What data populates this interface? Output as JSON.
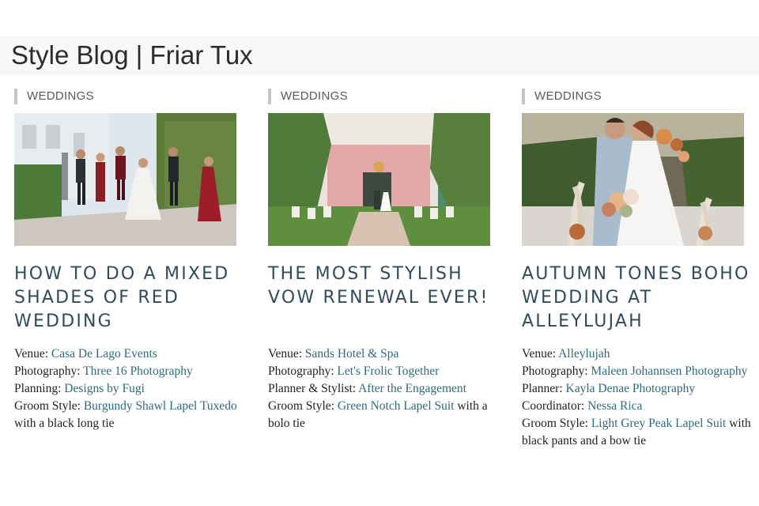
{
  "page": {
    "title": "Style Blog | Friar Tux"
  },
  "colors": {
    "headline": "#2f4b5c",
    "link": "#2e6a7d",
    "category_bar": "#c6c6c6",
    "header_bg": "#f8f8f8"
  },
  "posts": [
    {
      "category": "WEDDINGS",
      "image_alt": "Wedding party jumping in street beside ivy wall",
      "title": "HOW TO DO A MIXED SHADES OF RED WEDDING",
      "credits": [
        {
          "label": "Venue: ",
          "link": "Casa De Lago Events",
          "suffix": ""
        },
        {
          "label": "Photography: ",
          "link": "Three 16 Photography",
          "suffix": ""
        },
        {
          "label": "Planning: ",
          "link": "Designs by Fugi",
          "suffix": ""
        },
        {
          "label": "Groom Style: ",
          "link": "Burgundy Shawl Lapel Tuxedo",
          "suffix": " with a black long tie"
        }
      ]
    },
    {
      "category": "WEDDINGS",
      "image_alt": "Outdoor vow renewal ceremony at pink building",
      "title": "THE MOST STYLISH VOW RENEWAL EVER!",
      "credits": [
        {
          "label": "Venue: ",
          "link": "Sands Hotel & Spa",
          "suffix": ""
        },
        {
          "label": "Photography: ",
          "link": "Let's Frolic Together",
          "suffix": ""
        },
        {
          "label": "Planner & Stylist: ",
          "link": "After the Engagement",
          "suffix": ""
        },
        {
          "label": "Groom Style: ",
          "link": "Green Notch Lapel Suit",
          "suffix": " with a bolo tie"
        }
      ]
    },
    {
      "category": "WEDDINGS",
      "image_alt": "Couple embracing with autumn boho bouquet and pampas grass",
      "title": "AUTUMN TONES BOHO WEDDING AT ALLEYLUJAH",
      "credits": [
        {
          "label": "Venue: ",
          "link": "Alleylujah",
          "suffix": ""
        },
        {
          "label": "Photography: ",
          "link": "Maleen Johannsen Photography",
          "suffix": ""
        },
        {
          "label": "Planner: ",
          "link": "Kayla Denae Photography",
          "suffix": ""
        },
        {
          "label": "Coordinator: ",
          "link": "Nessa Rica",
          "suffix": ""
        },
        {
          "label": "Groom Style: ",
          "link": "Light Grey Peak Lapel Suit",
          "suffix": " with black pants and a bow tie"
        }
      ]
    }
  ]
}
